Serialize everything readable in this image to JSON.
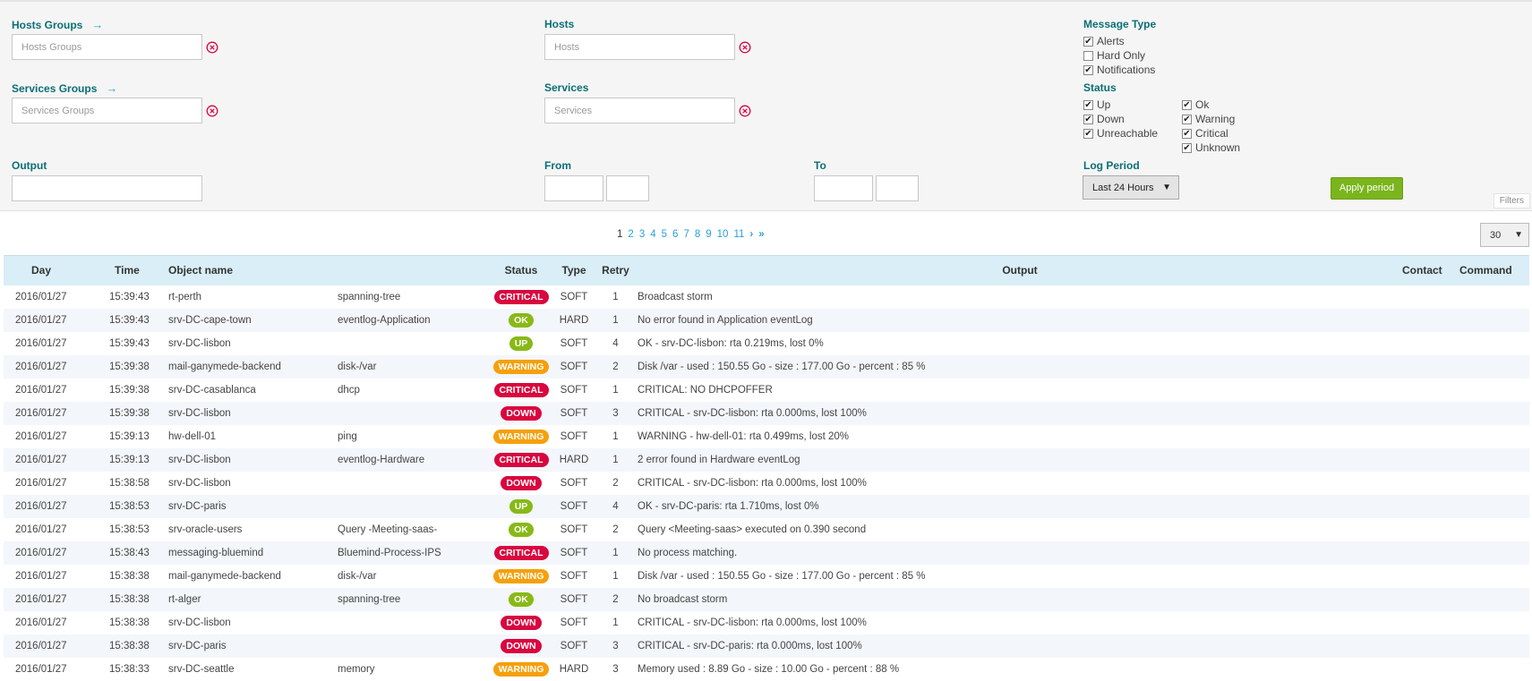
{
  "filters": {
    "hosts_groups": {
      "label": "Hosts Groups",
      "placeholder": "Hosts Groups"
    },
    "hosts": {
      "label": "Hosts",
      "placeholder": "Hosts"
    },
    "services_groups": {
      "label": "Services Groups",
      "placeholder": "Services Groups"
    },
    "services": {
      "label": "Services",
      "placeholder": "Services"
    },
    "output": {
      "label": "Output"
    },
    "from": {
      "label": "From"
    },
    "to": {
      "label": "To"
    },
    "message_type": {
      "label": "Message Type",
      "options": [
        {
          "label": "Alerts",
          "checked": true
        },
        {
          "label": "Hard Only",
          "checked": false
        },
        {
          "label": "Notifications",
          "checked": true
        }
      ]
    },
    "status": {
      "label": "Status",
      "host_options": [
        {
          "label": "Up",
          "checked": true
        },
        {
          "label": "Down",
          "checked": true
        },
        {
          "label": "Unreachable",
          "checked": true
        }
      ],
      "service_options": [
        {
          "label": "Ok",
          "checked": true
        },
        {
          "label": "Warning",
          "checked": true
        },
        {
          "label": "Critical",
          "checked": true
        },
        {
          "label": "Unknown",
          "checked": true
        }
      ]
    },
    "log_period": {
      "label": "Log Period",
      "value": "Last 24 Hours"
    },
    "apply_label": "Apply period",
    "filters_tag": "Filters",
    "arrow": "→"
  },
  "pagination": {
    "current": "1",
    "pages": [
      "2",
      "3",
      "4",
      "5",
      "6",
      "7",
      "8",
      "9",
      "10",
      "11"
    ],
    "next": "›",
    "last": "»"
  },
  "per_page": "30",
  "colors": {
    "critical": "#d9063f",
    "ok": "#88b917",
    "up": "#88b917",
    "warning": "#f5a00c",
    "down": "#d9063f"
  },
  "table": {
    "headers": {
      "day": "Day",
      "time": "Time",
      "object": "Object name",
      "status": "Status",
      "type": "Type",
      "retry": "Retry",
      "output": "Output",
      "contact": "Contact",
      "command": "Command"
    },
    "rows": [
      {
        "day": "2016/01/27",
        "time": "15:39:43",
        "host": "rt-perth",
        "service": "spanning-tree",
        "status": "CRITICAL",
        "kind": "critical",
        "type": "SOFT",
        "retry": "1",
        "output": "Broadcast storm"
      },
      {
        "day": "2016/01/27",
        "time": "15:39:43",
        "host": "srv-DC-cape-town",
        "service": "eventlog-Application",
        "status": "OK",
        "kind": "ok",
        "type": "HARD",
        "retry": "1",
        "output": "No error found in Application eventLog"
      },
      {
        "day": "2016/01/27",
        "time": "15:39:43",
        "host": "srv-DC-lisbon",
        "service": "",
        "status": "UP",
        "kind": "up",
        "type": "SOFT",
        "retry": "4",
        "output": "OK - srv-DC-lisbon: rta 0.219ms, lost 0%"
      },
      {
        "day": "2016/01/27",
        "time": "15:39:38",
        "host": "mail-ganymede-backend",
        "service": "disk-/var",
        "status": "WARNING",
        "kind": "warning",
        "type": "SOFT",
        "retry": "2",
        "output": "Disk /var - used : 150.55 Go - size : 177.00 Go - percent : 85 %"
      },
      {
        "day": "2016/01/27",
        "time": "15:39:38",
        "host": "srv-DC-casablanca",
        "service": "dhcp",
        "status": "CRITICAL",
        "kind": "critical",
        "type": "SOFT",
        "retry": "1",
        "output": "CRITICAL: NO DHCPOFFER"
      },
      {
        "day": "2016/01/27",
        "time": "15:39:38",
        "host": "srv-DC-lisbon",
        "service": "",
        "status": "DOWN",
        "kind": "down",
        "type": "SOFT",
        "retry": "3",
        "output": "CRITICAL - srv-DC-lisbon: rta 0.000ms, lost 100%"
      },
      {
        "day": "2016/01/27",
        "time": "15:39:13",
        "host": "hw-dell-01",
        "service": "ping",
        "status": "WARNING",
        "kind": "warning",
        "type": "SOFT",
        "retry": "1",
        "output": "WARNING - hw-dell-01: rta 0.499ms, lost 20%"
      },
      {
        "day": "2016/01/27",
        "time": "15:39:13",
        "host": "srv-DC-lisbon",
        "service": "eventlog-Hardware",
        "status": "CRITICAL",
        "kind": "critical",
        "type": "HARD",
        "retry": "1",
        "output": "2 error found in Hardware eventLog"
      },
      {
        "day": "2016/01/27",
        "time": "15:38:58",
        "host": "srv-DC-lisbon",
        "service": "",
        "status": "DOWN",
        "kind": "down",
        "type": "SOFT",
        "retry": "2",
        "output": "CRITICAL - srv-DC-lisbon: rta 0.000ms, lost 100%"
      },
      {
        "day": "2016/01/27",
        "time": "15:38:53",
        "host": "srv-DC-paris",
        "service": "",
        "status": "UP",
        "kind": "up",
        "type": "SOFT",
        "retry": "4",
        "output": "OK - srv-DC-paris: rta 1.710ms, lost 0%"
      },
      {
        "day": "2016/01/27",
        "time": "15:38:53",
        "host": "srv-oracle-users",
        "service": "Query -Meeting-saas-",
        "status": "OK",
        "kind": "ok",
        "type": "SOFT",
        "retry": "2",
        "output": "Query <Meeting-saas> executed on 0.390 second"
      },
      {
        "day": "2016/01/27",
        "time": "15:38:43",
        "host": "messaging-bluemind",
        "service": "Bluemind-Process-IPS",
        "status": "CRITICAL",
        "kind": "critical",
        "type": "SOFT",
        "retry": "1",
        "output": "No process matching."
      },
      {
        "day": "2016/01/27",
        "time": "15:38:38",
        "host": "mail-ganymede-backend",
        "service": "disk-/var",
        "status": "WARNING",
        "kind": "warning",
        "type": "SOFT",
        "retry": "1",
        "output": "Disk /var - used : 150.55 Go - size : 177.00 Go - percent : 85 %"
      },
      {
        "day": "2016/01/27",
        "time": "15:38:38",
        "host": "rt-alger",
        "service": "spanning-tree",
        "status": "OK",
        "kind": "ok",
        "type": "SOFT",
        "retry": "2",
        "output": "No broadcast storm"
      },
      {
        "day": "2016/01/27",
        "time": "15:38:38",
        "host": "srv-DC-lisbon",
        "service": "",
        "status": "DOWN",
        "kind": "down",
        "type": "SOFT",
        "retry": "1",
        "output": "CRITICAL - srv-DC-lisbon: rta 0.000ms, lost 100%"
      },
      {
        "day": "2016/01/27",
        "time": "15:38:38",
        "host": "srv-DC-paris",
        "service": "",
        "status": "DOWN",
        "kind": "down",
        "type": "SOFT",
        "retry": "3",
        "output": "CRITICAL - srv-DC-paris: rta 0.000ms, lost 100%"
      },
      {
        "day": "2016/01/27",
        "time": "15:38:33",
        "host": "srv-DC-seattle",
        "service": "memory",
        "status": "WARNING",
        "kind": "warning",
        "type": "HARD",
        "retry": "3",
        "output": "Memory used : 8.89 Go - size : 10.00 Go - percent : 88 %"
      }
    ]
  }
}
